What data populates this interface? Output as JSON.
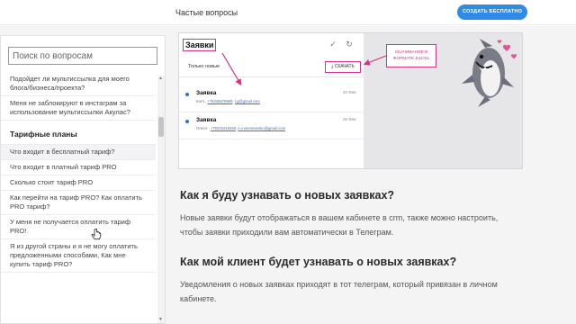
{
  "header": {
    "title": "Частые вопросы",
    "cta_label": "СОЗДАТЬ БЕСПЛАТНО",
    "accent": "#2e8be6"
  },
  "sidebar": {
    "search_placeholder": "Поиск по вопросам",
    "items_top": [
      "Подойдет ли мультиссылка для моего блога/бизнеса/проекта?",
      "Меня не заблокируют в инстаграм за использование мультиссылки Акулас?"
    ],
    "section_title": "Тарифные планы",
    "items": [
      "Что входит в бесплатный тариф?",
      "Что входит в платный тариф PRO",
      "Сколько стоит тариф PRO",
      "Как перейти на тариф PRO? Как оплатить PRO тариф?",
      "У меня не получается оплатить тариф PRO!",
      "Я из другой страны и я не могу оплатить предложенными способами, Как мне купить тариф PRO?"
    ],
    "active_index": 0
  },
  "screenshot": {
    "panel_title": "Заявки",
    "filter_label": "Только новые",
    "export_label": "СКАЧАТЬ",
    "note": "СКАЧИВАНИЕ В ФОРМАТЕ EXCEL",
    "leads": [
      {
        "name": "Заявка",
        "date": "26 Фев",
        "contact_name": "Катя ,",
        "phone": "+79245678909",
        "email": "t.g@gmail.com"
      },
      {
        "name": "Заявка",
        "date": "26 Фев",
        "contact_name": "Олеся ,",
        "phone": "+79233418155",
        "email": "o.v.veremeenko@gmail.com"
      }
    ],
    "highlight_color": "#d63384"
  },
  "content": {
    "q1": "Как я буду узнавать о новых заявках?",
    "a1": "Новые заявки будут отображаться в вашем кабинете в crm, также можно настроить, чтобы заявки приходили вам автоматически в Телеграм.",
    "q2": "Как мой клиент будет узнавать о новых заявках?",
    "a2": "Уведомления о новых заявках приходят в тот телеграм, который привязан в личном кабинете."
  }
}
